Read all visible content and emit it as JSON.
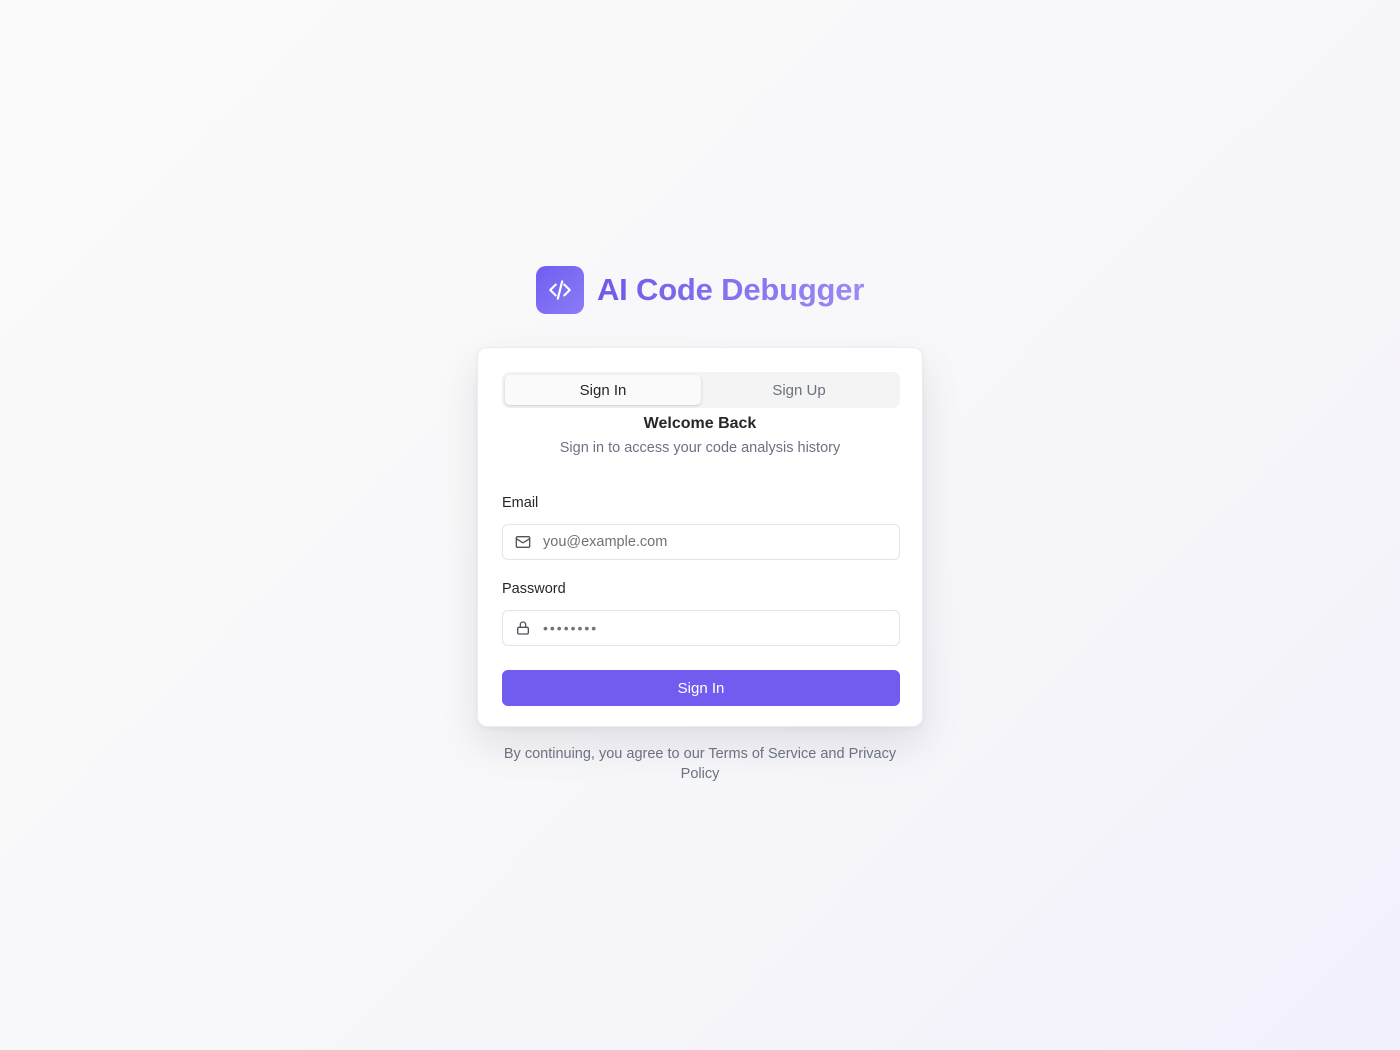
{
  "app": {
    "title": "AI Code Debugger",
    "logo_icon": "code-brackets-icon"
  },
  "auth": {
    "tabs": [
      {
        "label": "Sign In",
        "active": true
      },
      {
        "label": "Sign Up",
        "active": false
      }
    ],
    "heading": "Welcome Back",
    "subheading": "Sign in to access your code analysis history",
    "email": {
      "label": "Email",
      "placeholder": "you@example.com",
      "value": "",
      "icon": "mail-icon"
    },
    "password": {
      "label": "Password",
      "placeholder": "••••••••",
      "value": "",
      "icon": "lock-icon"
    },
    "submit_label": "Sign In"
  },
  "footer": {
    "terms_text": "By continuing, you agree to our Terms of Service and Privacy Policy"
  },
  "colors": {
    "accent": "#715cf0",
    "accent_light": "#9a8bf5",
    "text_muted": "#6b7280"
  }
}
